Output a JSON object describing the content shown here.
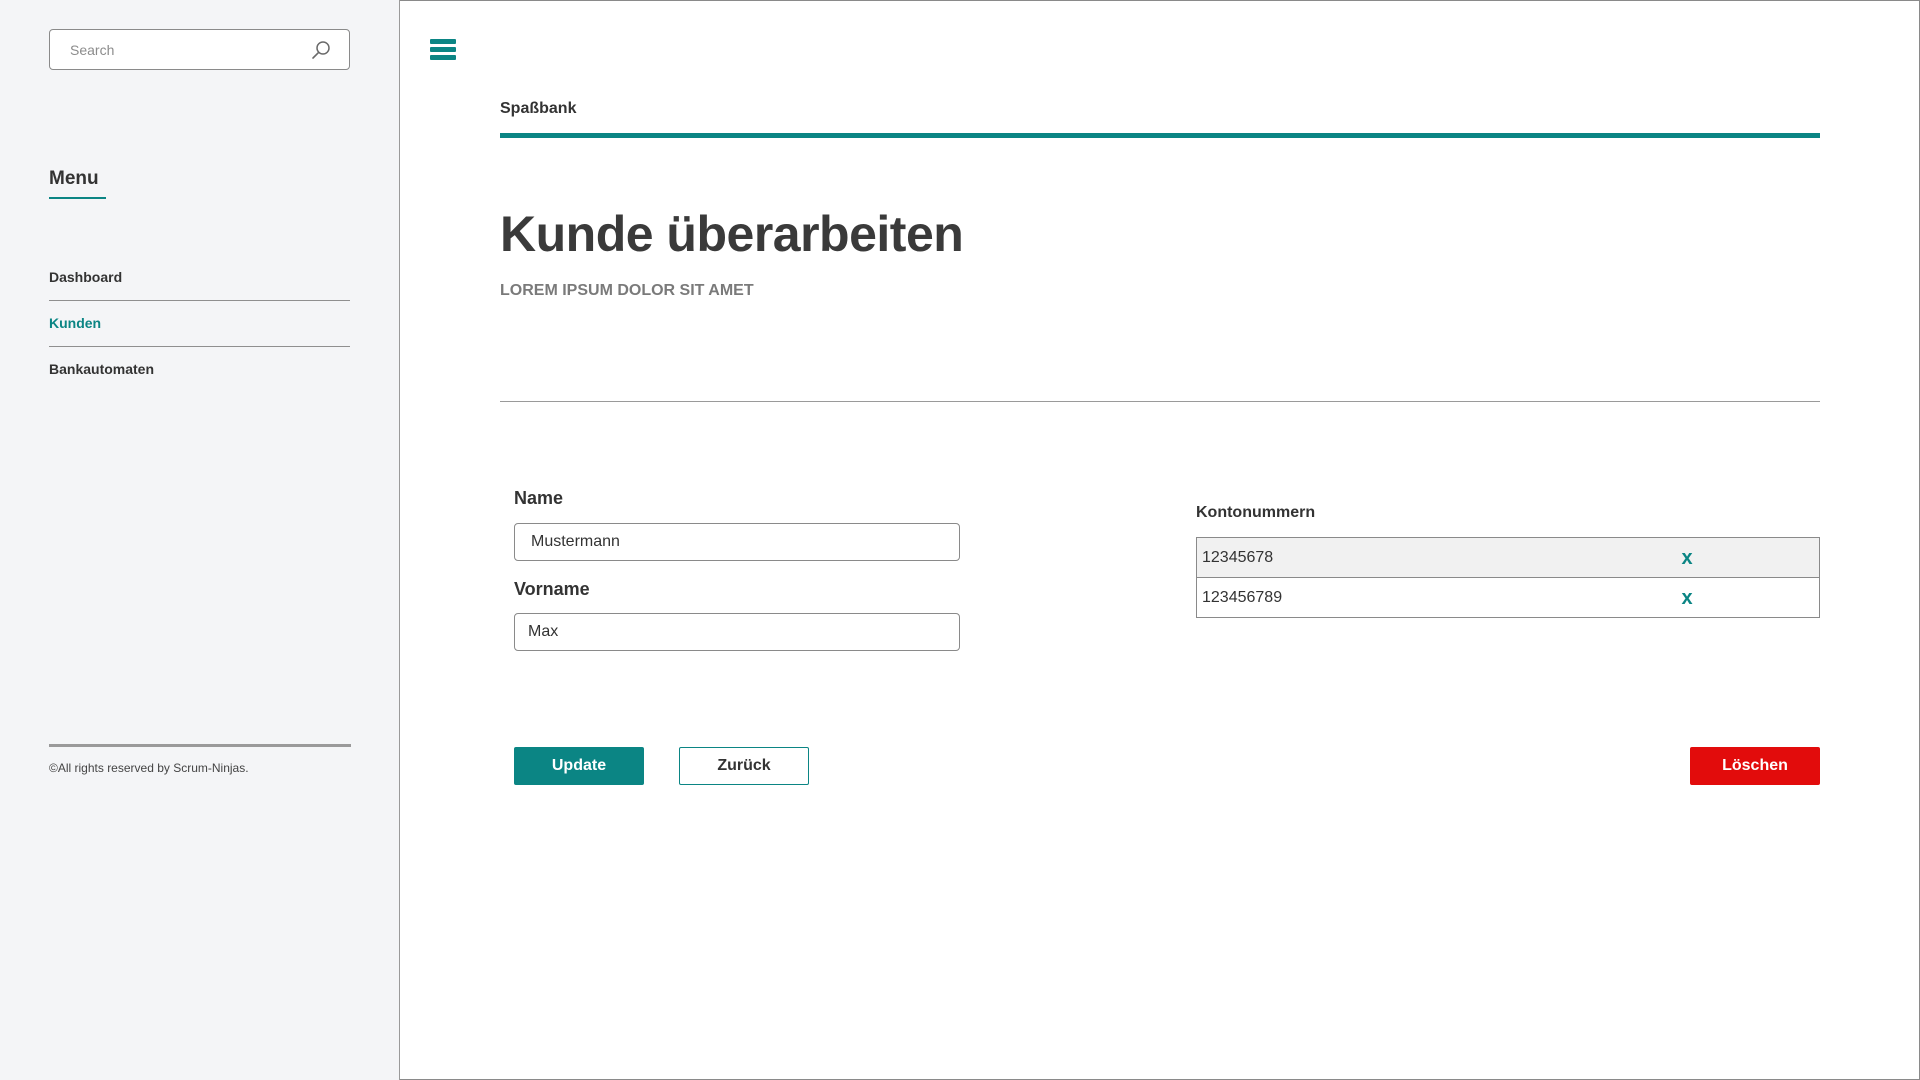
{
  "search": {
    "placeholder": "Search"
  },
  "sidebar": {
    "menu_title": "Menu",
    "items": [
      {
        "label": "Dashboard",
        "active": false
      },
      {
        "label": "Kunden",
        "active": true
      },
      {
        "label": "Bankautomaten",
        "active": false
      }
    ],
    "footer": "©All rights reserved by Scrum-Ninjas."
  },
  "header": {
    "brand": "Spaßbank"
  },
  "page": {
    "title": "Kunde überarbeiten",
    "subtitle": "LOREM IPSUM DOLOR SIT AMET"
  },
  "form": {
    "name_label": "Name",
    "name_value": "Mustermann",
    "vorname_label": "Vorname",
    "vorname_value": "Max"
  },
  "konten": {
    "label": "Kontonummern",
    "rows": [
      {
        "number": "12345678",
        "delete_icon": "x"
      },
      {
        "number": "123456789",
        "delete_icon": "x"
      }
    ]
  },
  "buttons": {
    "update": "Update",
    "back": "Zurück",
    "delete": "Löschen"
  },
  "colors": {
    "accent": "#0b8584",
    "danger": "#e20c0c",
    "sidebar_bg": "#f4f5f7"
  }
}
